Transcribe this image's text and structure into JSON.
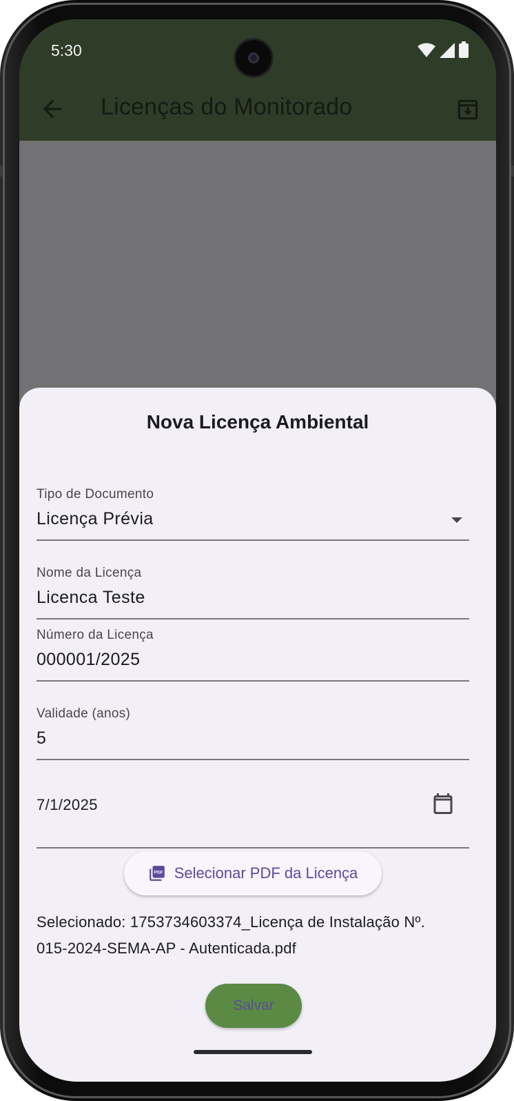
{
  "status_bar": {
    "time": "5:30"
  },
  "appbar": {
    "title": "Licenças do Monitorado",
    "back_icon": "arrow-back-icon",
    "action_icon": "archive-download-icon"
  },
  "sheet": {
    "title": "Nova Licença Ambiental",
    "tipo": {
      "label": "Tipo de Documento",
      "value": "Licença Prévia"
    },
    "nome": {
      "label": "Nome da Licença",
      "value": "Licenca Teste"
    },
    "numero": {
      "label": "Número da Licença",
      "value": "000001/2025"
    },
    "validade": {
      "label": "Validade (anos)",
      "value": "5"
    },
    "data": {
      "value": "7/1/2025"
    },
    "pdf_button": "Selecionar PDF da Licença",
    "selected_line1": "Selecionado: 1753734603374_Licença de Instalação Nº.",
    "selected_line2": "015-2024-SEMA-AP - Autenticada.pdf",
    "save_button": "Salvar"
  },
  "colors": {
    "appbar": "#2f3d28",
    "sheet": "#f2eff7",
    "save": "#5a8a44",
    "accent": "#5b4a9c"
  }
}
